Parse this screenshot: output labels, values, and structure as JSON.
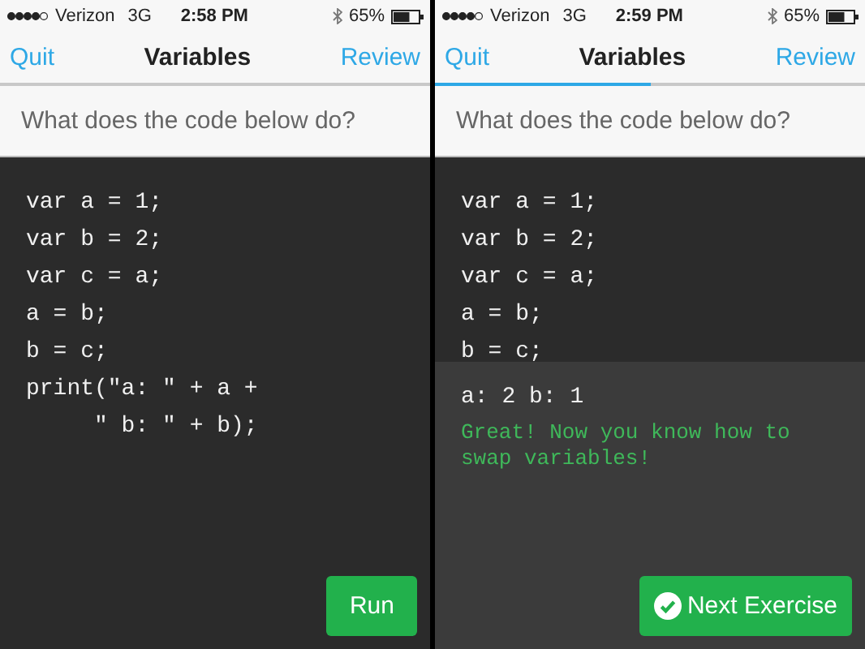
{
  "phones": [
    {
      "status": {
        "carrier": "Verizon",
        "network": "3G",
        "time": "2:58 PM",
        "battery": "65%"
      },
      "nav": {
        "left": "Quit",
        "title": "Variables",
        "right": "Review"
      },
      "question": "What does the code below do?",
      "code": [
        "var a = 1;",
        "var b = 2;",
        "var c = a;",
        "a = b;",
        "b = c;",
        "print(\"a: \" + a +",
        "     \" b: \" + b);"
      ],
      "action": {
        "kind": "run",
        "label": "Run"
      }
    },
    {
      "status": {
        "carrier": "Verizon",
        "network": "3G",
        "time": "2:59 PM",
        "battery": "65%"
      },
      "nav": {
        "left": "Quit",
        "title": "Variables",
        "right": "Review"
      },
      "progress": {
        "level": 0.5
      },
      "question": "What does the code below do?",
      "code": [
        "var a = 1;",
        "var b = 2;",
        "var c = a;",
        "a = b;",
        "b = c;"
      ],
      "output": {
        "result": "a: 2 b: 1",
        "message": "Great! Now you know how to swap variables!"
      },
      "action": {
        "kind": "next",
        "label": "Next Exercise"
      }
    }
  ]
}
